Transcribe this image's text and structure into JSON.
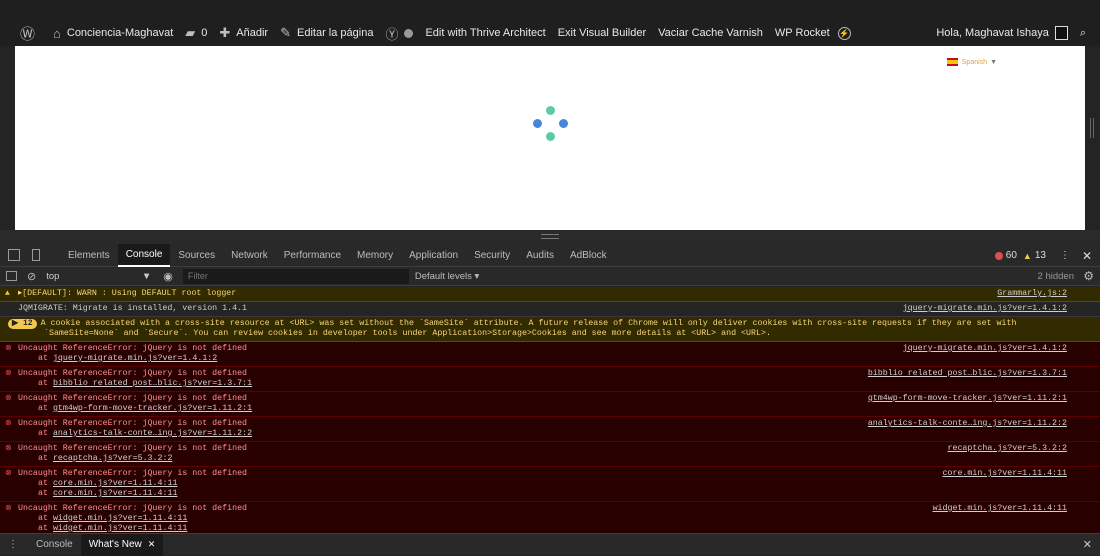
{
  "adminbar": {
    "site_name": "Conciencia-Maghavat",
    "comments_count": "0",
    "add_label": "Añadir",
    "edit_label": "Editar la página",
    "thrive_label": "Edit with Thrive Architect",
    "exit_builder_label": "Exit Visual Builder",
    "varnish_label": "Vaciar Cache Varnish",
    "rocket_label": "WP Rocket",
    "greeting": "Hola, Maghavat Ishaya"
  },
  "page": {
    "language_label": "Spanish"
  },
  "devtools": {
    "tabs": [
      "Elements",
      "Console",
      "Sources",
      "Network",
      "Performance",
      "Memory",
      "Application",
      "Security",
      "Audits",
      "AdBlock"
    ],
    "active_tab": "Console",
    "error_count": "60",
    "warning_count": "13",
    "context": "top",
    "filter_placeholder": "Filter",
    "levels_label": "Default levels ▾",
    "hidden_label": "2 hidden"
  },
  "console": {
    "warn_default": "▸[DEFAULT]: WARN : Using DEFAULT root logger",
    "warn_default_src": "Grammarly.js:2",
    "jqmigrate": "JQMIGRATE: Migrate is installed, version 1.4.1",
    "jqmigrate_src": "jquery-migrate.min.js?ver=1.4.1:2",
    "cookie_count": "12",
    "cookie_line1": "A cookie associated with a cross-site resource at <URL> was set without the `SameSite` attribute. A future release of Chrome will only deliver cookies with cross-site requests if they are set with",
    "cookie_line2": "`SameSite=None` and `Secure`. You can review cookies in developer tools under Application>Storage>Cookies and see more details at <URL> and <URL>.",
    "error_text": "Uncaught ReferenceError: jQuery is not defined",
    "errors": [
      {
        "src": "jquery-migrate.min.js?ver=1.4.1:2",
        "stack": [
          "jquery-migrate.min.js?ver=1.4.1:2"
        ]
      },
      {
        "src": "bibblio related post…blic.js?ver=1.3.7:1",
        "stack": [
          "bibblio related post…blic.js?ver=1.3.7:1"
        ]
      },
      {
        "src": "gtm4wp-form-move-tracker.js?ver=1.11.2:1",
        "stack": [
          "gtm4wp-form-move-tracker.js?ver=1.11.2:1"
        ]
      },
      {
        "src": "analytics-talk-conte…ing.js?ver=1.11.2:2",
        "stack": [
          "analytics-talk-conte…ing.js?ver=1.11.2:2"
        ]
      },
      {
        "src": "recaptcha.js?ver=5.3.2:2",
        "stack": [
          "recaptcha.js?ver=5.3.2:2"
        ]
      },
      {
        "src": "core.min.js?ver=1.11.4:11",
        "stack": [
          "core.min.js?ver=1.11.4:11",
          "core.min.js?ver=1.11.4:11"
        ]
      },
      {
        "src": "widget.min.js?ver=1.11.4:11",
        "stack": [
          "widget.min.js?ver=1.11.4:11",
          "widget.min.js?ver=1.11.4:11"
        ]
      }
    ],
    "at_prefix": "at"
  },
  "drawer": {
    "tabs": [
      "Console",
      "What's New"
    ],
    "active": "What's New"
  },
  "colors": {
    "spinner_teal": "#5cc9a7",
    "spinner_blue": "#4a86d8"
  },
  "icons": [
    "wordpress-icon",
    "home-icon",
    "comment-icon",
    "plus-icon",
    "pencil-icon",
    "yoast-icon",
    "rocket-icon",
    "search-icon",
    "inspect-icon",
    "device-icon",
    "sidebar-icon",
    "clear-icon",
    "eye-icon",
    "gear-icon",
    "close-icon",
    "more-icon"
  ]
}
